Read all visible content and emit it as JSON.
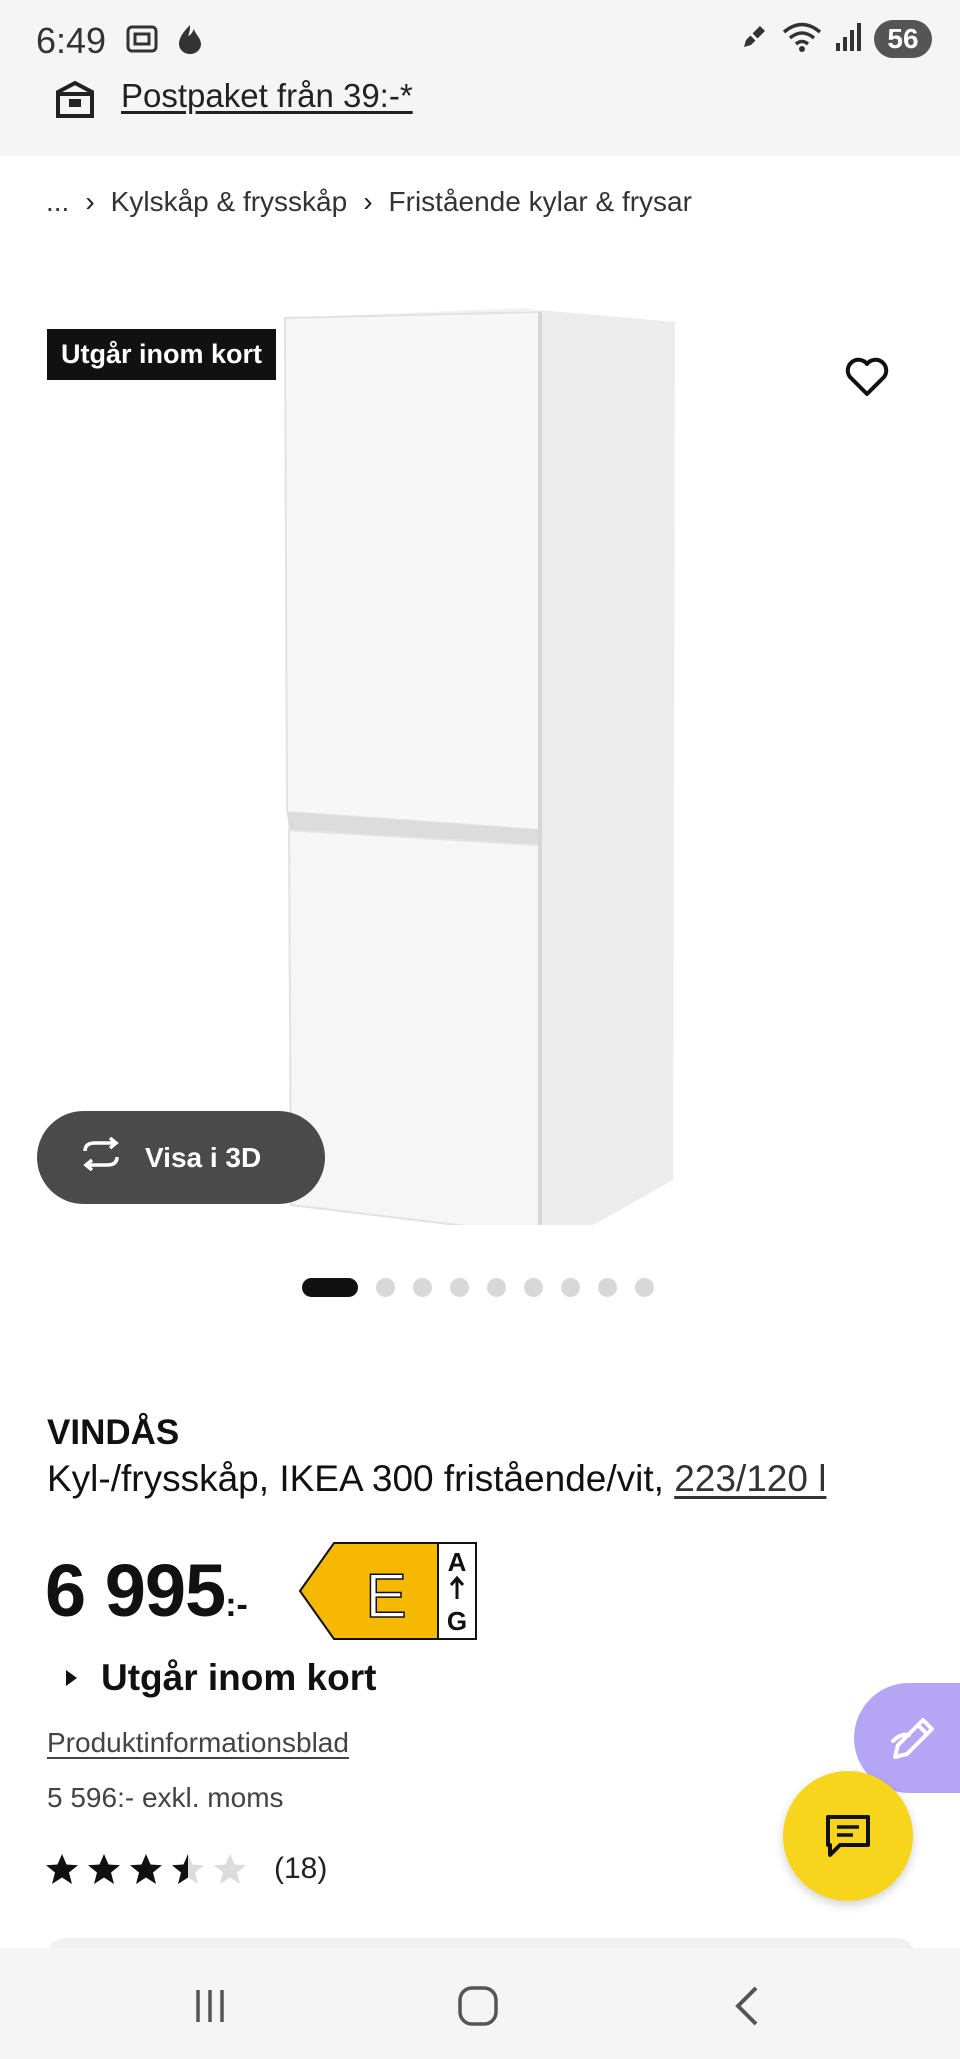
{
  "status_bar": {
    "time": "6:49",
    "battery": "56",
    "left_icons": [
      "screenshot-icon",
      "fire-icon"
    ],
    "right_icons": [
      "pen-off-icon",
      "wifi-icon",
      "signal-icon"
    ]
  },
  "postpaket": {
    "label": "Postpaket från 39:-*"
  },
  "breadcrumb": {
    "items": [
      "...",
      "Kylskåp & frysskåp",
      "Fristående kylar & frysar"
    ]
  },
  "image": {
    "badge": "Utgår inom kort",
    "view_3d_label": "Visa i 3D",
    "total_images": 9,
    "active_image": 1
  },
  "product": {
    "name": "VINDÅS",
    "description": "Kyl-/frysskåp, IKEA 300 fristående/vit, ",
    "volume_link": "223/120 l",
    "price_main": "6 995",
    "price_suffix": ":-",
    "energy_class": "E",
    "energy_top": "A",
    "energy_bottom": "G",
    "availability": "Utgår inom kort",
    "info_sheet_link": "Produktinformationsblad",
    "price_excl_vat": "5 596:- exkl. moms",
    "rating": 3.5,
    "rating_max": 5,
    "review_count": "(18)"
  },
  "colors": {
    "accent_yellow": "#f7d51d",
    "edit_purple": "#b5a6f5",
    "energy_yellow": "#f6b800"
  }
}
